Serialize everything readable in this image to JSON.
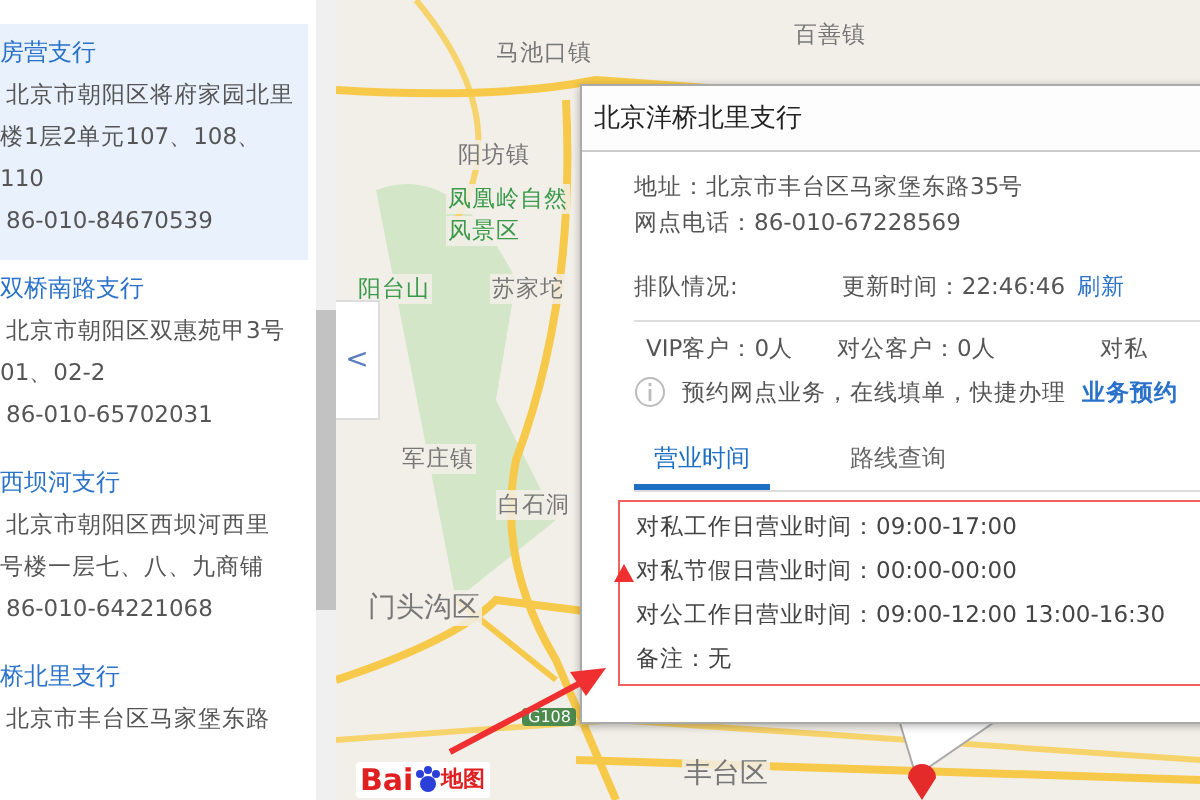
{
  "branch_list": [
    {
      "name": "房营支行",
      "address_lines": [
        "北京市朝阳区将府家园北里",
        "楼1层2单元107、108、",
        "110"
      ],
      "phone": "86-010-84670539",
      "selected": true
    },
    {
      "name": "双桥南路支行",
      "address_lines": [
        "北京市朝阳区双惠苑甲3号",
        "01、02-2"
      ],
      "phone": "86-010-65702031",
      "selected": false
    },
    {
      "name": "西坝河支行",
      "address_lines": [
        "北京市朝阳区西坝河西里",
        "号楼一层七、八、九商铺"
      ],
      "phone": "86-010-64221068",
      "selected": false
    },
    {
      "name": "桥北里支行",
      "address_lines": [
        "北京市丰台区马家堡东路"
      ],
      "selected": false
    }
  ],
  "collapse_button": "<",
  "map": {
    "labels": [
      {
        "text": "马池口镇",
        "kind": "place"
      },
      {
        "text": "百善镇",
        "kind": "place"
      },
      {
        "text": "阳坊镇",
        "kind": "place"
      },
      {
        "text": "凤凰岭自然",
        "kind": "park"
      },
      {
        "text": "风景区",
        "kind": "park"
      },
      {
        "text": "阳台山",
        "kind": "park"
      },
      {
        "text": "苏家坨",
        "kind": "place"
      },
      {
        "text": "军庄镇",
        "kind": "place"
      },
      {
        "text": "白石洞",
        "kind": "place"
      },
      {
        "text": "门头沟区",
        "kind": "district"
      },
      {
        "text": "丰台区",
        "kind": "district"
      }
    ],
    "road_sign": "G108",
    "logo": {
      "text_1": "Bai",
      "text_2": "地图"
    }
  },
  "popup": {
    "title": "北京洋桥北里支行",
    "address": "地址：北京市丰台区马家堡东路35号",
    "phone": "网点电话：86-010-67228569",
    "queue_label": "排队情况:",
    "update_time": "更新时间：22:46:46",
    "refresh_link": "刷新",
    "customer_counts": [
      "VIP客户：0人",
      "对公客户：0人",
      "对私"
    ],
    "notice": "预约网点业务，在线填单，快捷办理",
    "booking_link": "业务预约",
    "tabs": [
      {
        "label": "营业时间",
        "selected": true
      },
      {
        "label": "路线查询",
        "selected": false
      }
    ],
    "hours": [
      "对私工作日营业时间：09:00-17:00",
      "对私节假日营业时间：00:00-00:00",
      "对公工作日营业时间：09:00-12:00  13:00-16:30",
      "备注：无"
    ]
  }
}
